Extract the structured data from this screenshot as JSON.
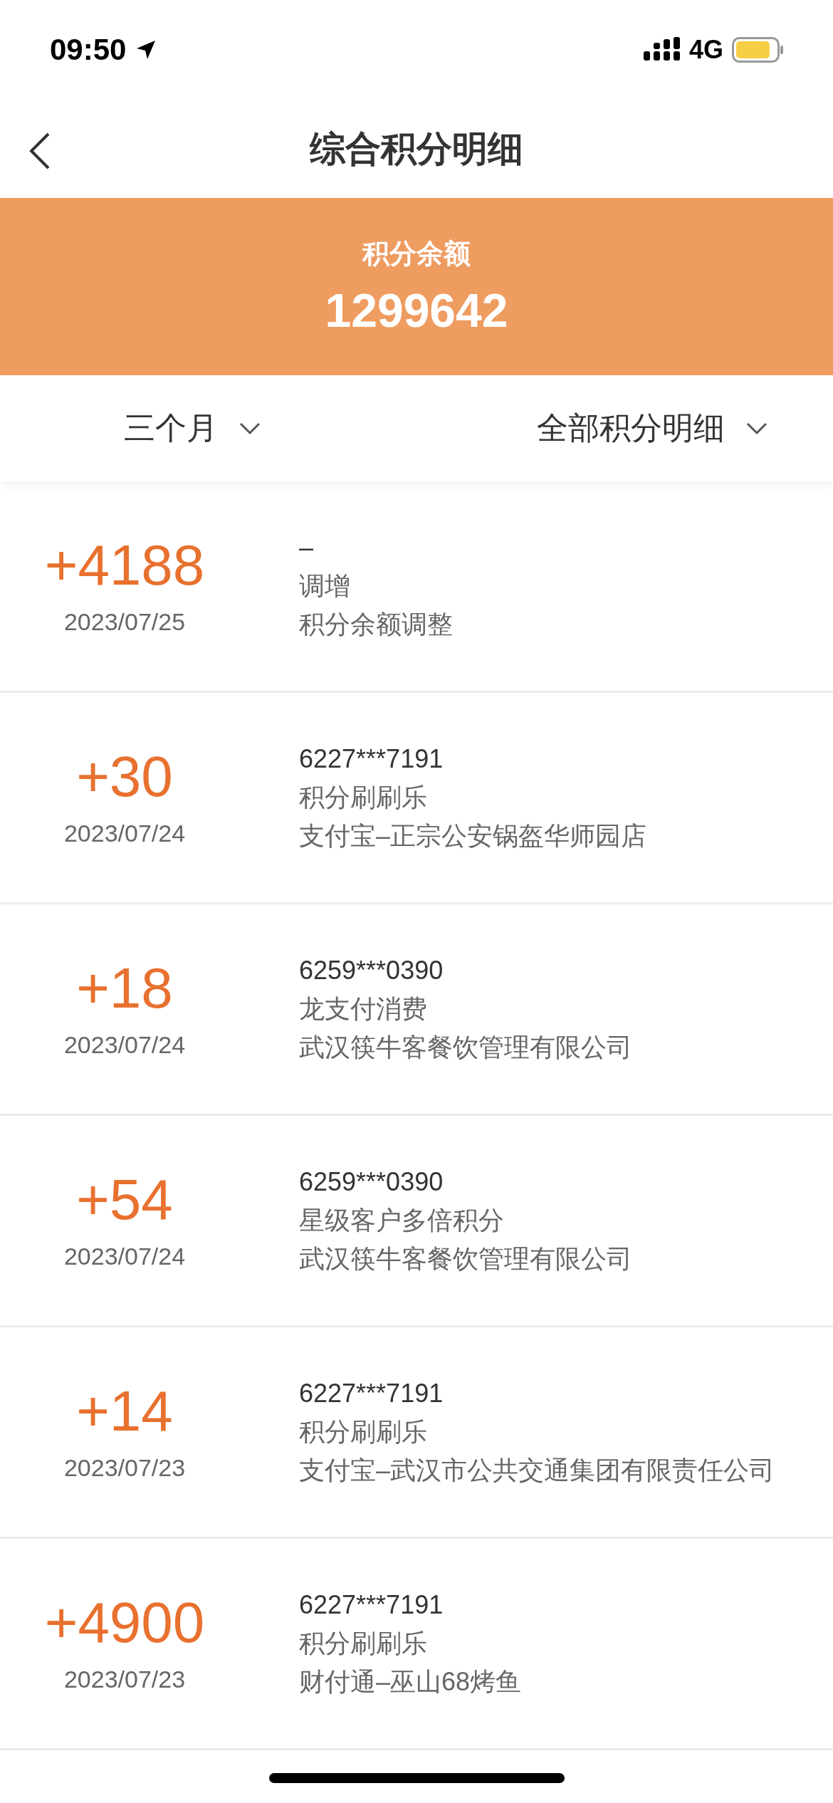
{
  "status_bar": {
    "time": "09:50",
    "network": "4G"
  },
  "nav": {
    "title": "综合积分明细"
  },
  "balance": {
    "label": "积分余额",
    "value": "1299642"
  },
  "filters": [
    {
      "label": "三个月"
    },
    {
      "label": "全部积分明细"
    }
  ],
  "records": [
    {
      "amount": "+4188",
      "date": "2023/07/25",
      "card": "–",
      "type": "调增",
      "merchant": "积分余额调整"
    },
    {
      "amount": "+30",
      "date": "2023/07/24",
      "card": "6227***7191",
      "type": "积分刷刷乐",
      "merchant": "支付宝–正宗公安锅盔华师园店"
    },
    {
      "amount": "+18",
      "date": "2023/07/24",
      "card": "6259***0390",
      "type": "龙支付消费",
      "merchant": "武汉筷牛客餐饮管理有限公司"
    },
    {
      "amount": "+54",
      "date": "2023/07/24",
      "card": "6259***0390",
      "type": "星级客户多倍积分",
      "merchant": "武汉筷牛客餐饮管理有限公司"
    },
    {
      "amount": "+14",
      "date": "2023/07/23",
      "card": "6227***7191",
      "type": "积分刷刷乐",
      "merchant": "支付宝–武汉市公共交通集团有限责任公司"
    },
    {
      "amount": "+4900",
      "date": "2023/07/23",
      "card": "6227***7191",
      "type": "积分刷刷乐",
      "merchant": "财付通–巫山68烤鱼"
    }
  ]
}
